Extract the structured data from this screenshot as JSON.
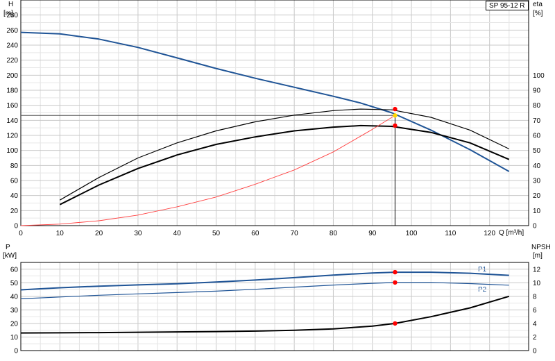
{
  "chart_data": [
    {
      "type": "line",
      "title": "",
      "model": "SP 95-12 R",
      "xlabel": "Q [m³/h]",
      "x_ticks": [
        "0",
        "10",
        "20",
        "30",
        "40",
        "50",
        "60",
        "70",
        "80",
        "90",
        "100",
        "110",
        "120"
      ],
      "xlim": [
        0,
        130
      ],
      "ylabel_left": [
        "H",
        "[m]"
      ],
      "ylim_left": [
        0,
        300
      ],
      "y_ticks_left": [
        "0",
        "20",
        "40",
        "60",
        "80",
        "100",
        "120",
        "140",
        "160",
        "180",
        "200",
        "220",
        "240",
        "260",
        "280"
      ],
      "ylabel_right": [
        "eta",
        "[%]"
      ],
      "ylim_right": [
        0,
        150
      ],
      "y_ticks_right": [
        "0",
        "10",
        "20",
        "30",
        "40",
        "50",
        "60",
        "70",
        "80",
        "90",
        "100"
      ],
      "grid": true,
      "operating_point": {
        "q": 95.8,
        "h": 146.5
      },
      "series": [
        {
          "role": "head",
          "axis": "left",
          "color": "#1f5496",
          "x": [
            0,
            10,
            20,
            30,
            40,
            50,
            60,
            70,
            80,
            87,
            95,
            105,
            115,
            125
          ],
          "y": [
            257,
            255,
            248,
            237,
            223,
            209,
            196,
            184,
            172,
            163,
            150,
            127,
            101,
            72
          ]
        },
        {
          "role": "efficiency",
          "axis": "right",
          "color": "#000000",
          "x": [
            10,
            20,
            30,
            40,
            50,
            60,
            70,
            80,
            87,
            95,
            105,
            115,
            125
          ],
          "y": [
            14,
            27,
            38,
            47,
            54,
            59,
            63,
            65.5,
            66.5,
            66,
            62,
            55,
            44
          ]
        },
        {
          "role": "efficiency-2",
          "axis": "right",
          "color": "#000000",
          "x": [
            10,
            20,
            30,
            40,
            50,
            60,
            70,
            80,
            87,
            95,
            105,
            115,
            125
          ],
          "y": [
            17,
            32,
            45,
            55,
            63,
            69,
            73.5,
            76.5,
            77.5,
            77,
            72,
            63.5,
            51
          ]
        },
        {
          "role": "system-curve",
          "axis": "left",
          "color": "#ff4040",
          "x": [
            0,
            10,
            20,
            30,
            40,
            50,
            60,
            70,
            80,
            90,
            95.8
          ],
          "y": [
            0,
            2,
            6.5,
            14,
            25,
            38,
            55,
            74,
            98,
            128,
            146.5
          ]
        }
      ],
      "markers": [
        {
          "axis": "left",
          "x": 95.8,
          "y": 146.5,
          "color": "#ffd700"
        },
        {
          "axis": "right",
          "x": 95.8,
          "y": 77.5,
          "color": "#ff0000"
        },
        {
          "axis": "right",
          "x": 95.8,
          "y": 66.5,
          "color": "#ff0000"
        }
      ]
    },
    {
      "type": "line",
      "title": "",
      "xlim": [
        0,
        130
      ],
      "ylabel_left": [
        "P",
        "[kW]"
      ],
      "ylim_left": [
        0,
        65
      ],
      "y_ticks_left": [
        "0",
        "10",
        "20",
        "30",
        "40",
        "50",
        "60"
      ],
      "ylabel_right": [
        "NPSH",
        "[m]"
      ],
      "ylim_right": [
        0,
        13
      ],
      "y_ticks_right": [
        "0",
        "2",
        "4",
        "6",
        "8",
        "10",
        "12"
      ],
      "grid": true,
      "series": [
        {
          "name": "P1",
          "axis": "left",
          "color": "#1f5496",
          "x": [
            0,
            10,
            20,
            30,
            40,
            50,
            60,
            70,
            80,
            90,
            95.8,
            105,
            115,
            125
          ],
          "y": [
            44.8,
            46.3,
            47.5,
            48.4,
            49.3,
            50.5,
            52,
            53.8,
            55.7,
            57.2,
            57.8,
            57.8,
            57,
            55.5
          ]
        },
        {
          "name": "P2",
          "axis": "left",
          "color": "#1f5496",
          "x": [
            0,
            10,
            20,
            30,
            40,
            50,
            60,
            70,
            80,
            90,
            95.8,
            105,
            115,
            125
          ],
          "y": [
            38.2,
            39.5,
            40.8,
            41.8,
            42.8,
            43.8,
            45.2,
            46.8,
            48.3,
            49.6,
            50.2,
            50.2,
            49.4,
            48.2
          ]
        },
        {
          "role": "npsh",
          "axis": "right",
          "color": "#000000",
          "x": [
            0,
            10,
            20,
            30,
            40,
            50,
            60,
            70,
            80,
            90,
            95.8,
            105,
            115,
            125
          ],
          "y": [
            2.6,
            2.62,
            2.65,
            2.7,
            2.75,
            2.8,
            2.88,
            3.0,
            3.2,
            3.6,
            4.0,
            5.0,
            6.3,
            8.0
          ]
        }
      ],
      "markers": [
        {
          "axis": "left",
          "x": 95.8,
          "y": 57.8,
          "color": "#ff0000"
        },
        {
          "axis": "left",
          "x": 95.8,
          "y": 50.2,
          "color": "#ff0000"
        },
        {
          "axis": "right",
          "x": 95.8,
          "y": 4.0,
          "color": "#ff0000"
        }
      ]
    }
  ]
}
